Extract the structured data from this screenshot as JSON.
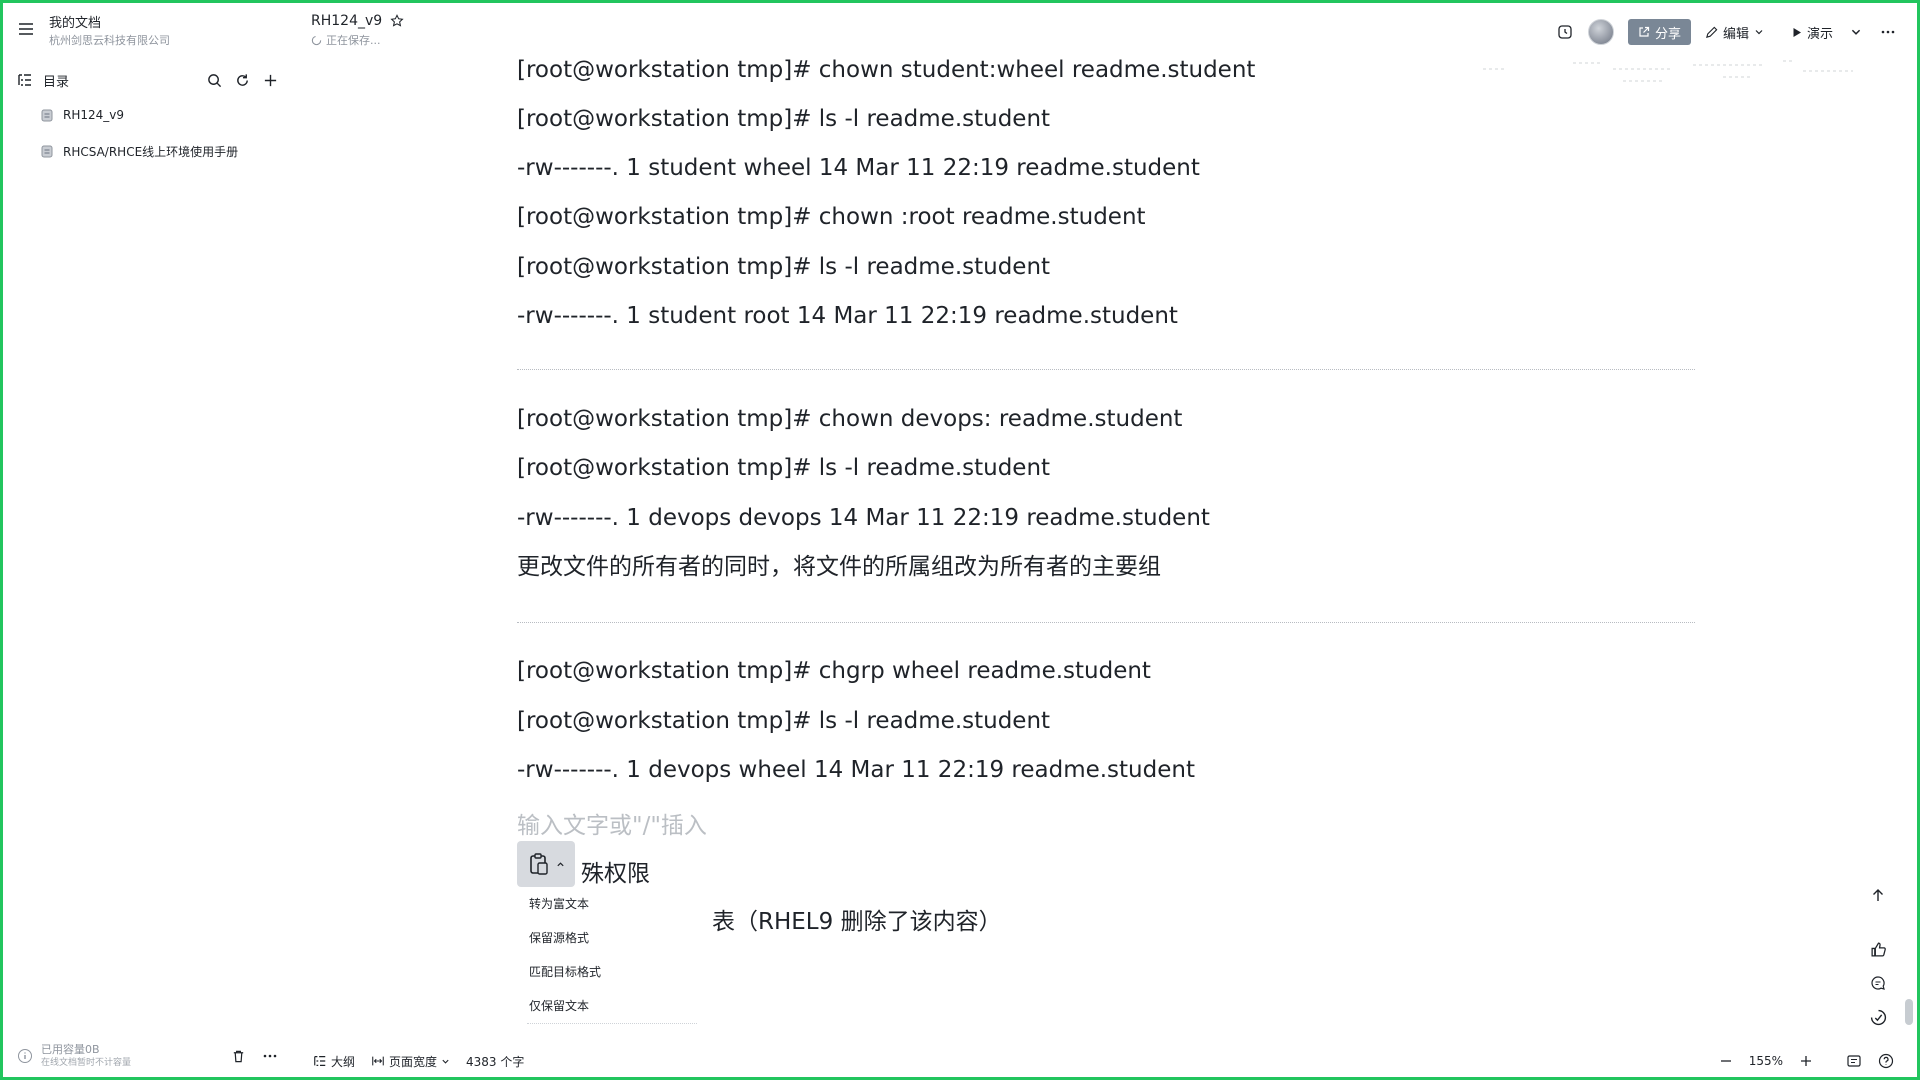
{
  "sidebar": {
    "workspace_title": "我的文档",
    "workspace_subtitle": "杭州剑思云科技有限公司",
    "toc_label": "目录",
    "docs": [
      {
        "label": "RH124_v9"
      },
      {
        "label": "RHCSA/RHCE线上环境使用手册"
      }
    ],
    "storage_label": "已用容量0B",
    "storage_note": "在线文档暂时不计容量"
  },
  "header": {
    "doc_title": "RH124_v9",
    "save_status": "正在保存..."
  },
  "toolbar": {
    "share_label": "分享",
    "edit_label": "编辑",
    "present_label": "演示"
  },
  "content": {
    "lines": [
      "[root@workstation tmp]# chown student:wheel readme.student",
      "[root@workstation tmp]# ls -l readme.student",
      "-rw-------. 1 student wheel 14 Mar 11 22:19 readme.student",
      "[root@workstation tmp]# chown :root readme.student",
      "[root@workstation tmp]# ls -l readme.student",
      "-rw-------. 1 student root 14 Mar 11 22:19 readme.student",
      "[root@workstation tmp]# chown devops: readme.student",
      "[root@workstation tmp]# ls -l readme.student",
      "-rw-------. 1 devops devops 14 Mar 11 22:19 readme.student",
      "更改文件的所有者的同时，将文件的所属组改为所有者的主要组",
      "[root@workstation tmp]# chgrp wheel readme.student",
      "[root@workstation tmp]# ls -l readme.student",
      "-rw-------. 1 devops wheel 14 Mar 11 22:19 readme.student"
    ],
    "placeholder": "输入文字或\"/\"插入",
    "heading_partial": "殊权限",
    "table_note": "表（RHEL9 删除了该内容）"
  },
  "paste_menu": {
    "items": [
      "转为富文本",
      "保留源格式",
      "匹配目标格式",
      "仅保留文本"
    ]
  },
  "statusbar": {
    "outline_label": "大纲",
    "page_width_label": "页面宽度",
    "word_count": "4383 个字",
    "zoom": "155%"
  },
  "colors": {
    "frame_border": "#22c55e",
    "share_button": "#7a8796",
    "text": "#1f2329",
    "muted": "#8f959e"
  }
}
